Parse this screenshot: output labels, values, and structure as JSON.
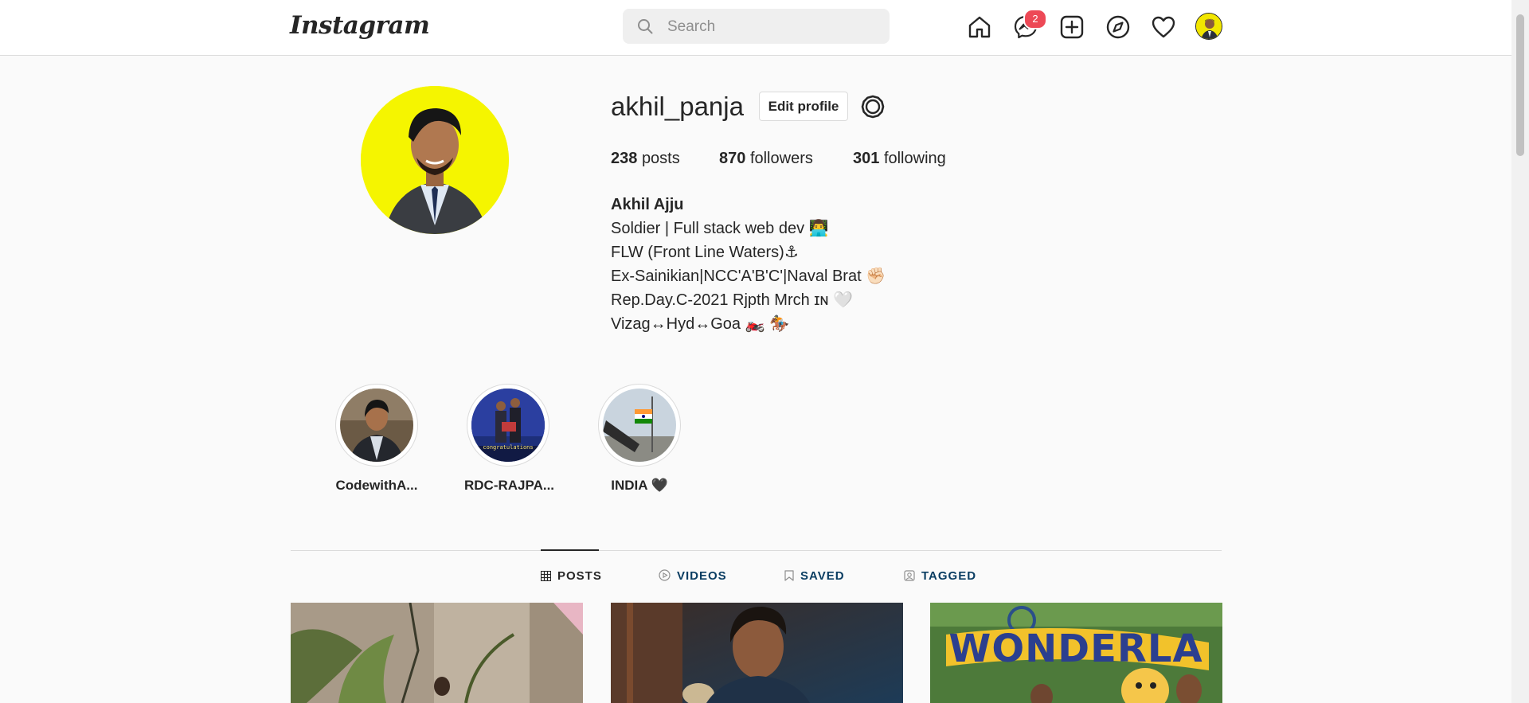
{
  "nav": {
    "logo": "Instagram",
    "search_placeholder": "Search",
    "messages_badge": "2",
    "icons": [
      "home-icon",
      "messenger-icon",
      "new-post-icon",
      "explore-icon",
      "activity-heart-icon"
    ]
  },
  "profile": {
    "username": "akhil_panja",
    "edit_label": "Edit profile",
    "stats": {
      "posts_count": "238",
      "posts_label": "posts",
      "followers_count": "870",
      "followers_label": "followers",
      "following_count": "301",
      "following_label": "following"
    },
    "bio": {
      "name": "Akhil Ajju",
      "lines": [
        "Soldier | Full stack web dev 👨‍💻",
        "FLW (Front Line Waters)⚓",
        "Ex-Sainikian|NCC'A'B'C'|Naval Brat ✊🏻",
        "Rep.Day.C-2021 Rjpth Mrch ɪɴ 🤍",
        "Vizag↔Hyd↔Goa 🏍️ 🏇"
      ]
    }
  },
  "highlights": [
    {
      "label": "CodewithA..."
    },
    {
      "label": "RDC-RAJPA...",
      "overlay_text": "congratulations"
    },
    {
      "label": "INDIA 🖤"
    }
  ],
  "tabs": [
    {
      "label": "POSTS",
      "active": true
    },
    {
      "label": "VIDEOS",
      "active": false
    },
    {
      "label": "SAVED",
      "active": false
    },
    {
      "label": "TAGGED",
      "active": false
    }
  ],
  "posts": [
    {
      "overlay_text": ""
    },
    {
      "overlay_text": ""
    },
    {
      "overlay_text": "WONDERLA"
    }
  ],
  "colors": {
    "badge": "#ed4956",
    "avatar_bg": "#f5f500",
    "border": "#dbdbdb",
    "text": "#262626",
    "muted": "#8e8e8e"
  }
}
